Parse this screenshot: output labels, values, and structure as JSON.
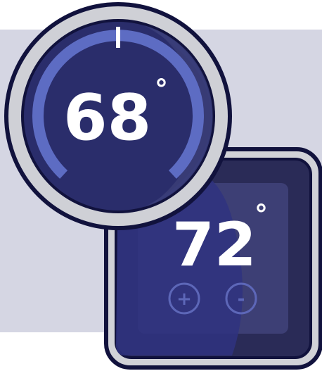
{
  "round_thermostat": {
    "temperature": "68",
    "degree": "°"
  },
  "square_thermostat": {
    "temperature": "72",
    "degree": "°",
    "increase_label": "+",
    "decrease_label": "-"
  },
  "colors": {
    "background_panel": "#d5d6e3",
    "dial_navy": "#2a2d6b",
    "outline_dark": "#11123d",
    "bezel_gray": "#cfd0d6",
    "arc_blue": "#5d6cc3",
    "text_white": "#ffffff"
  }
}
